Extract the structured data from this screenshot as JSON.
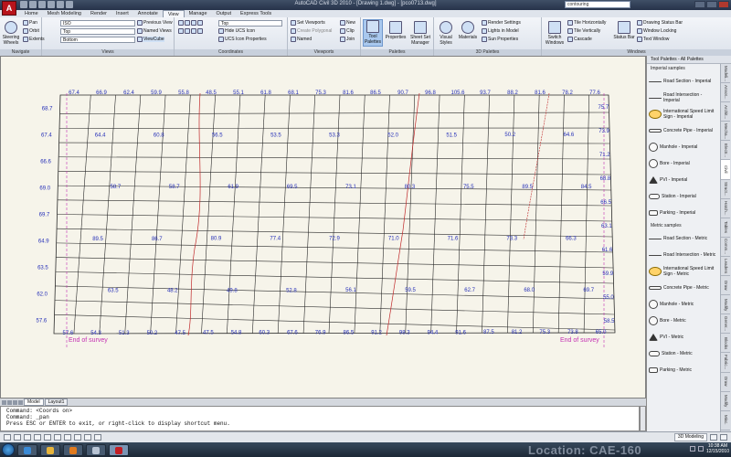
{
  "app": {
    "logo_letter": "A",
    "title": "AutoCAD Civil 3D 2010 - [Drawing 1.dwg] - [pco0713.dwg]",
    "search_value": "contouring"
  },
  "menu_tabs": [
    "Home",
    "Mesh Modeling",
    "Render",
    "Insert",
    "Annotate",
    "View",
    "Manage",
    "Output",
    "Express Tools"
  ],
  "active_tab": "View",
  "ribbon": {
    "navigate": {
      "label": "Navigate",
      "steering": "Steering Wheels",
      "pan": "Pan",
      "orbit": "Orbit",
      "extents": "Extents"
    },
    "views": {
      "label": "Views",
      "combo1": "ISO",
      "combo2": "Top",
      "combo3": "Bottom",
      "prev": "Previous View",
      "named": "Named Views",
      "viewcube": "ViewCube"
    },
    "coordinates": {
      "label": "Coordinates",
      "combo": "Top",
      "hide_ucs": "Hide UCS Icon",
      "ucs_props": "UCS Icon Properties"
    },
    "viewports": {
      "label": "Viewports",
      "set": "Set Viewports",
      "create_poly": "Create Polygonal",
      "named": "Named",
      "new": "New",
      "clip": "Clip",
      "join": "Join"
    },
    "palettes": {
      "label": "Palettes",
      "tool_palettes": "Tool Palettes",
      "properties": "Properties",
      "sheet_set": "Sheet Set Manager"
    },
    "palettes3d": {
      "label": "3D Palettes",
      "visual_styles": "Visual Styles",
      "materials": "Materials",
      "render_settings": "Render Settings",
      "lights": "Lights in Model",
      "sun": "Sun Properties"
    },
    "windows": {
      "label": "Windows",
      "switch": "Switch Windows",
      "tile_h": "Tile Horizontally",
      "tile_v": "Tile Vertically",
      "cascade": "Cascade",
      "status_bar": "Status Bar",
      "drawing_status": "Drawing Status Bar",
      "window_locking": "Window Locking",
      "text_window": "Text Window"
    }
  },
  "drawing": {
    "annotation_left": "End of survey",
    "annotation_right": "End of survey",
    "top_labels": [
      "67.4",
      "66.9",
      "62.4",
      "59.9",
      "55.8",
      "48.5",
      "55.1",
      "61.8",
      "68.1",
      "75.3",
      "81.6",
      "86.5",
      "90.7",
      "96.8",
      "105.6",
      "93.7",
      "88.2",
      "81.6",
      "78.2",
      "77.6"
    ],
    "bottom_labels": [
      "57.6",
      "54.3",
      "51.3",
      "50.2",
      "47.5",
      "47.5",
      "54.8",
      "60.3",
      "67.6",
      "76.9",
      "86.5",
      "91.2",
      "98.3",
      "94.4",
      "91.6",
      "87.5",
      "81.2",
      "75.3",
      "73.8",
      "65.0"
    ],
    "left_labels": [
      "68.7",
      "67.4",
      "66.6",
      "69.0",
      "69.7",
      "64.9",
      "63.5",
      "62.0",
      "57.6"
    ],
    "right_labels": [
      "75.7",
      "73.9",
      "71.2",
      "68.8",
      "66.5",
      "63.1",
      "61.6",
      "59.9",
      "55.0",
      "58.5"
    ],
    "grid_labels": [
      "64.4",
      "60.8",
      "56.5",
      "53.5",
      "53.3",
      "52.0",
      "51.5",
      "50.2",
      "64.6",
      "58.7",
      "58.7",
      "61.9",
      "69.5",
      "73.1",
      "80.3",
      "75.5",
      "89.5",
      "84.5",
      "89.5",
      "86.7",
      "80.9",
      "77.4",
      "72.9",
      "71.0",
      "71.6",
      "73.3",
      "66.3",
      "63.5",
      "48.2",
      "49.8",
      "52.8",
      "56.1",
      "59.5",
      "62.7",
      "68.0",
      "69.7"
    ]
  },
  "layout_tabs": [
    "Model",
    "Layout1"
  ],
  "command_lines": [
    "Command:  <Coords on>",
    "Command:  _pan",
    "Press ESC or ENTER to exit, or right-click to display shortcut menu."
  ],
  "palette": {
    "title": "Tool Palettes - All Palettes",
    "imperial_header": "Imperial samples",
    "imperial_items": [
      "Road Section - Imperial",
      "Road Intersection - Imperial",
      "International Speed Limit Sign - Imperial",
      "Concrete Pipe - Imperial",
      "Manhole - Imperial",
      "Bore - Imperial",
      "PVI - Imperial",
      "Station - Imperial",
      "Parking - Imperial"
    ],
    "metric_header": "Metric samples",
    "metric_items": [
      "Road Section - Metric",
      "Road Intersection - Metric",
      "International Speed Limit Sign - Metric",
      "Concrete Pipe - Metric",
      "Manhole - Metric",
      "Bore - Metric",
      "PVI - Metric",
      "Station - Metric",
      "Parking - Metric"
    ],
    "tabs": [
      "Modeli...",
      "Annot...",
      "Archit...",
      "Mecha...",
      "Electr...",
      "Civil",
      "Struct...",
      "Hatch...",
      "Tables",
      "Comm...",
      "Leaders",
      "Draw",
      "Modify",
      "Gener...",
      "Blocks",
      "Fabric...",
      "Draw",
      "Modify",
      "Misc."
    ],
    "active_tab": "Civil"
  },
  "status": {
    "workspace": "3D Modeling"
  },
  "taskbar": {
    "watermark": "Location: CAE-160",
    "time": "10:38 AM",
    "date": "12/15/2010"
  },
  "colors": {
    "grid_line": "#2a2a2a",
    "label": "#2630b8",
    "contour": "#c0282a",
    "annotation": "#c42fb2"
  }
}
